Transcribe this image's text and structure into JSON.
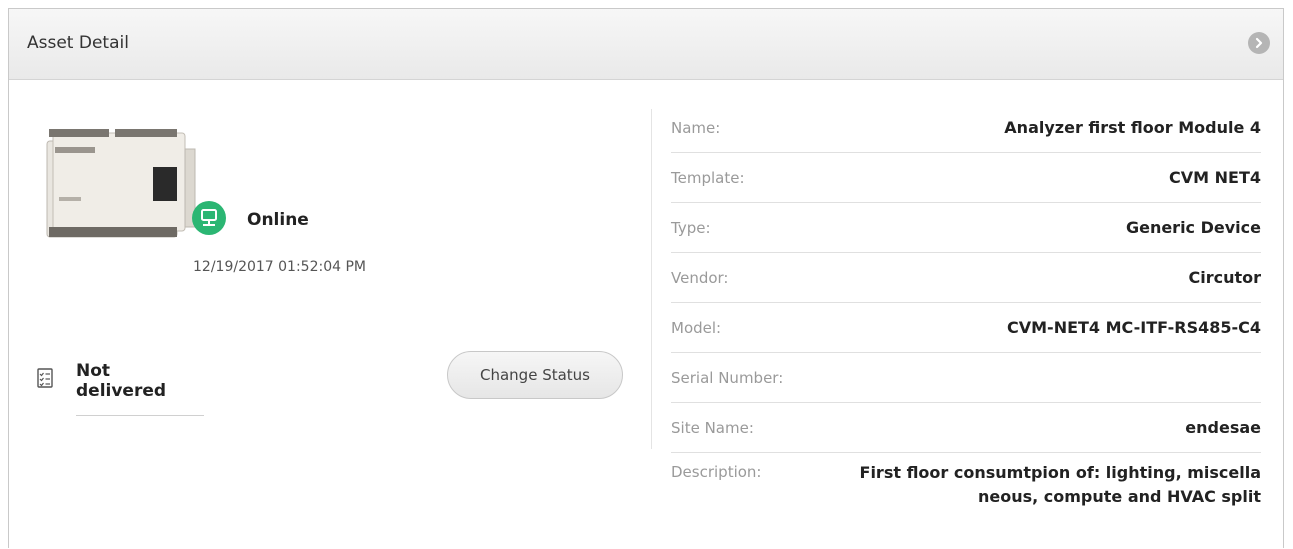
{
  "header": {
    "title": "Asset Detail",
    "action_icon": "chevron-right-circle-icon"
  },
  "status": {
    "label": "Online",
    "timestamp": "12/19/2017 01:52:04 PM",
    "icon": "network-monitor-icon",
    "color": "#2bb673"
  },
  "delivery": {
    "label": "Not delivered",
    "icon": "checklist-icon"
  },
  "actions": {
    "change_status_label": "Change Status"
  },
  "details": {
    "rows": [
      {
        "label": "Name:",
        "value": "Analyzer first floor Module 4"
      },
      {
        "label": "Template:",
        "value": "CVM NET4"
      },
      {
        "label": "Type:",
        "value": "Generic Device"
      },
      {
        "label": "Vendor:",
        "value": "Circutor"
      },
      {
        "label": "Model:",
        "value": "CVM-NET4 MC-ITF-RS485-C4"
      },
      {
        "label": "Serial Number:",
        "value": ""
      },
      {
        "label": "Site Name:",
        "value": "endesae"
      }
    ],
    "description": {
      "label": "Description:",
      "line1": "First floor consumtpion of: lighting, miscella",
      "line2": "neous, compute and HVAC split"
    }
  }
}
